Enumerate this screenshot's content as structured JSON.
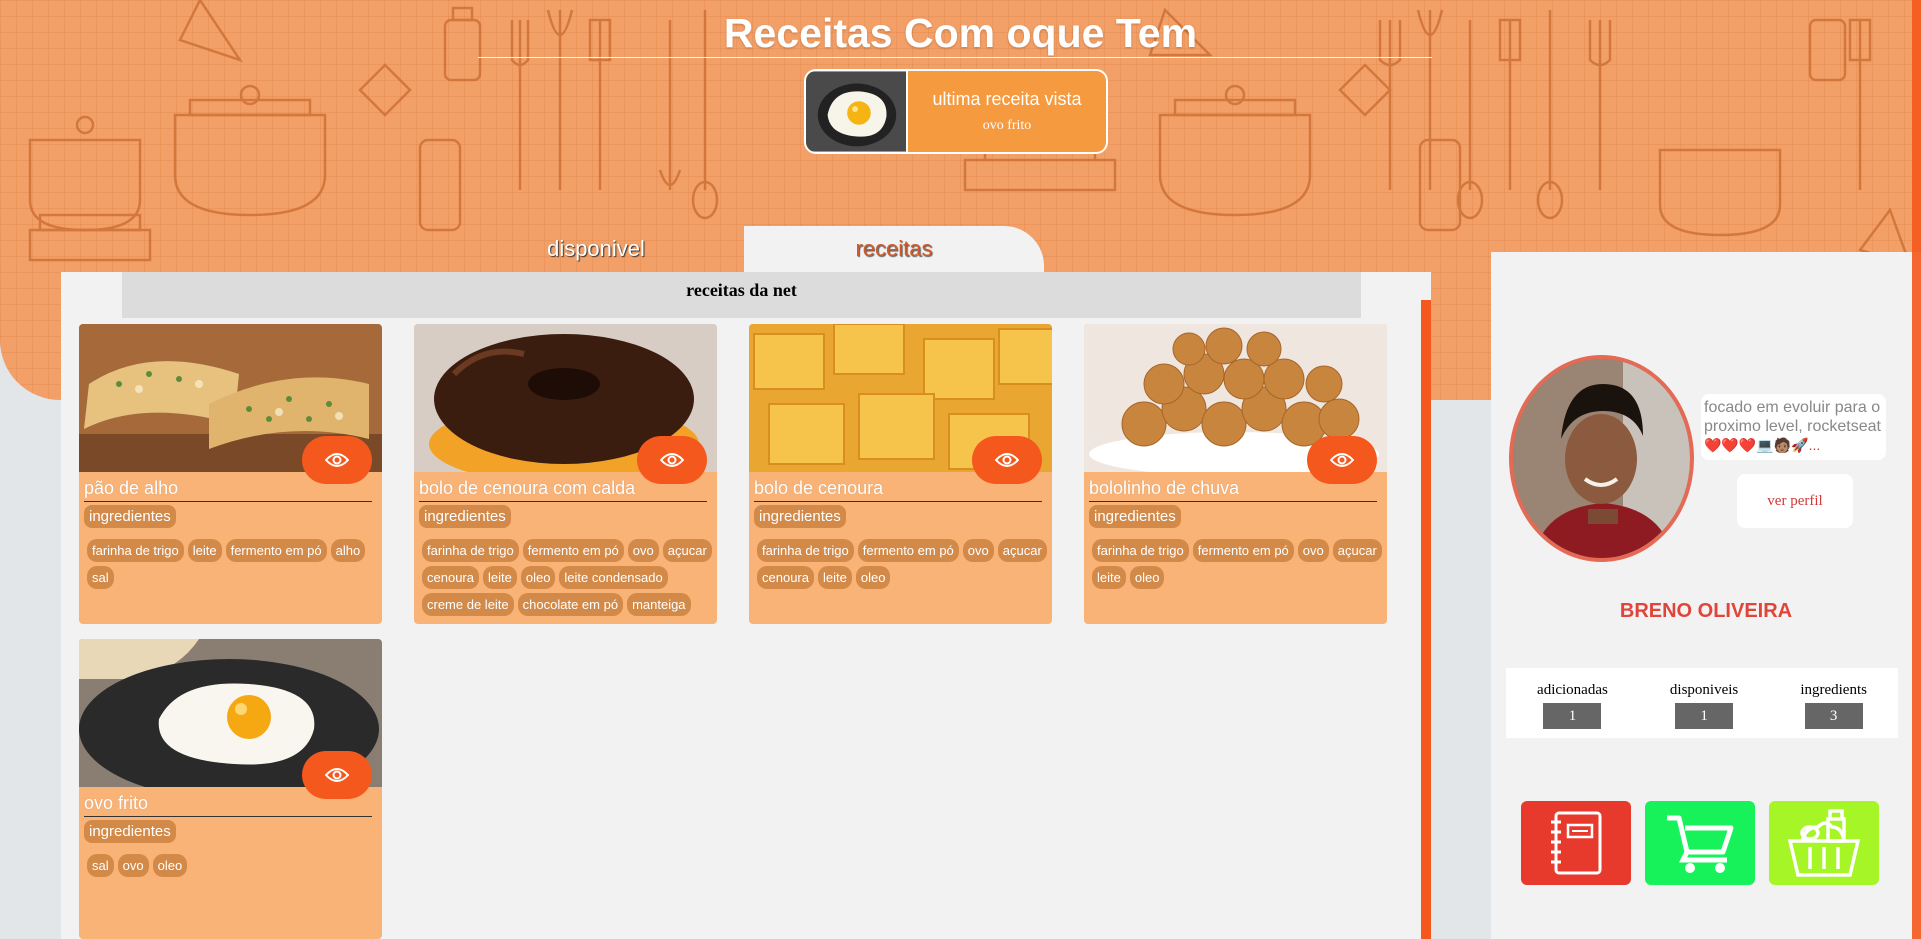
{
  "header": {
    "title": "Receitas Com oque Tem",
    "last_viewed": {
      "label": "ultima receita vista",
      "recipe": "ovo frito"
    }
  },
  "tabs": [
    {
      "label": "disponivel",
      "active": false
    },
    {
      "label": "receitas",
      "active": true
    }
  ],
  "section": {
    "title": "receitas da net"
  },
  "recipes": [
    {
      "title": "pão de alho",
      "ingredients_label": "ingredientes",
      "ingredients": [
        "farinha de trigo",
        "leite",
        "fermento em pó",
        "alho",
        "sal"
      ]
    },
    {
      "title": "bolo de cenoura com calda",
      "ingredients_label": "ingredientes",
      "ingredients": [
        "farinha de trigo",
        "fermento em pó",
        "ovo",
        "açucar",
        "cenoura",
        "leite",
        "oleo",
        "leite condensado",
        "creme de leite",
        "chocolate em pó",
        "manteiga"
      ]
    },
    {
      "title": "bolo de cenoura",
      "ingredients_label": "ingredientes",
      "ingredients": [
        "farinha de trigo",
        "fermento em pó",
        "ovo",
        "açucar",
        "cenoura",
        "leite",
        "oleo"
      ]
    },
    {
      "title": "bololinho de chuva",
      "ingredients_label": "ingredientes",
      "ingredients": [
        "farinha de trigo",
        "fermento em pó",
        "ovo",
        "açucar",
        "leite",
        "oleo"
      ]
    },
    {
      "title": "ovo frito",
      "ingredients_label": "ingredientes",
      "ingredients": [
        "sal",
        "ovo",
        "oleo"
      ]
    }
  ],
  "profile": {
    "bio": "focado em evoluir para o proximo level, rocketseat",
    "bio_emoji": "❤️❤️❤️💻🧑🏽🚀...",
    "view_profile_label": "ver perfil",
    "name": "BRENO OLIVEIRA",
    "stats": [
      {
        "label": "adicionadas",
        "value": "1"
      },
      {
        "label": "disponiveis",
        "value": "1"
      },
      {
        "label": "ingredients",
        "value": "3"
      }
    ]
  },
  "icons": {
    "recipe_book": "notebook-icon",
    "cart": "shopping-cart-icon",
    "basket": "grocery-basket-icon",
    "view": "eye-icon"
  },
  "colors": {
    "accent": "#f4581c",
    "card": "#f9b377",
    "chip": "#d38948",
    "book_button": "#e8392d",
    "cart_button": "#17f25a",
    "basket_button": "#a5f527"
  }
}
